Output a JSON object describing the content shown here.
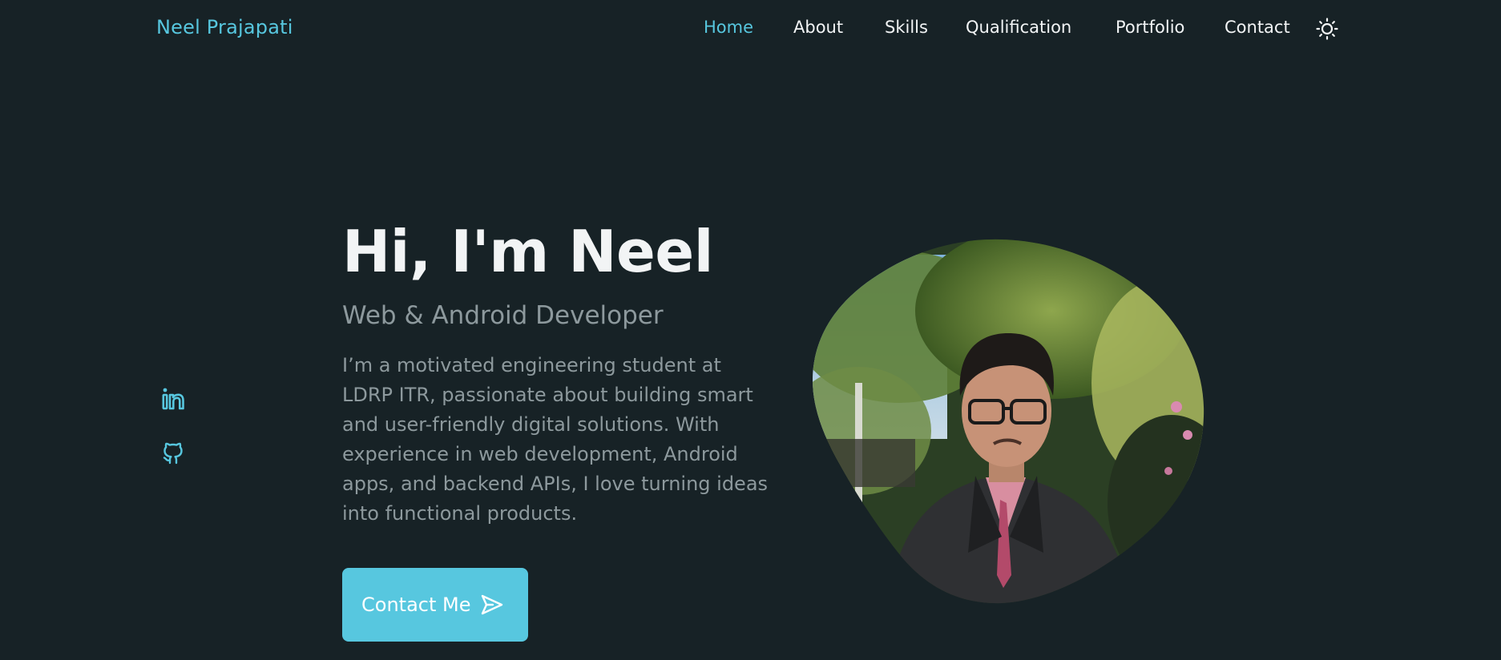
{
  "header": {
    "logo": "Neel Prajapati",
    "nav": [
      {
        "label": "Home",
        "active": true
      },
      {
        "label": "About"
      },
      {
        "label": "Skills"
      },
      {
        "label": "Qualification"
      },
      {
        "label": "Portfolio"
      },
      {
        "label": "Contact"
      }
    ],
    "theme_toggle_icon": "sun-icon"
  },
  "social": [
    {
      "icon": "linkedin-icon"
    },
    {
      "icon": "github-icon"
    }
  ],
  "hero": {
    "title": "Hi, I'm Neel",
    "subtitle": "Web & Android Developer",
    "description": "I’m a motivated engineering student at LDRP ITR, passionate about building smart and user-friendly digital solutions. With experience in web development, Android apps, and backend APIs, I love turning ideas into functional products.",
    "contact_button": {
      "label": "Contact Me",
      "icon": "send-icon"
    }
  },
  "colors": {
    "background": "#172226",
    "accent": "#57c7df",
    "text": "#f2f4f5",
    "muted": "#8d999d"
  }
}
